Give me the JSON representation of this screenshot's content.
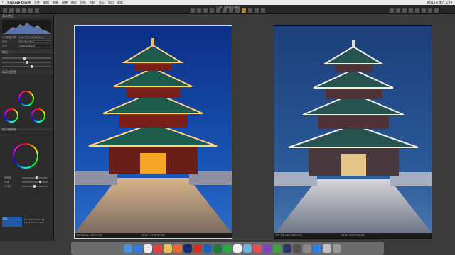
{
  "menubar": {
    "app_name": "Capture One 9",
    "items": [
      "文件",
      "编辑",
      "图像",
      "调整",
      "图层",
      "选择",
      "相机",
      "显示",
      "窗口",
      "帮助"
    ],
    "clock": "8月13日 周六 3:09"
  },
  "toolbar": {
    "title": "◁ 2016颐和园博客"
  },
  "sidebar": {
    "sections": [
      "基本特征",
      "曝光",
      "高动态范围",
      "色彩编辑器"
    ],
    "fields": [
      {
        "label": "ICC配置文件",
        "value": "Phase One IQ180 Flash"
      },
      {
        "label": "曲线",
        "value": "Film Standard"
      },
      {
        "label": "引擎",
        "value": "Capture One 9"
      }
    ],
    "slider_labels": [
      "饱和度",
      "亮度",
      "平滑度"
    ],
    "swatch_text": "影调",
    "info_lines": [
      "R 135 G 148 B 189",
      "L 128 a 155 b 200"
    ]
  },
  "left_photo": {
    "left_text": "ISO 100   1/6 s   f/8   24 mm",
    "center_text": "2016-7-24 09:48.CR2"
  },
  "right_photo": {
    "left_text": "ISO 100   1/6 s   f/8   24 mm",
    "center_text": "2016-7-24 09:48.CR2"
  },
  "colors": {
    "accent": "#b58a2a",
    "sky_left": "#1547a8",
    "sky_right": "#2b5a9a"
  }
}
